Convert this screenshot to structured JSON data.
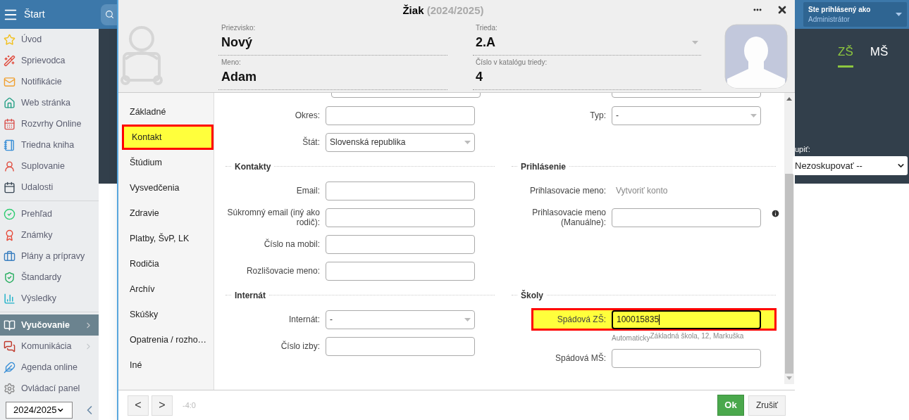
{
  "sidebar": {
    "title": "Štart",
    "groups": [
      {
        "items": [
          {
            "label": "Úvod",
            "selected": false,
            "has_submenu": false
          },
          {
            "label": "Sprievodca",
            "selected": false,
            "has_submenu": false
          },
          {
            "label": "Notifikácie",
            "selected": false,
            "has_submenu": false
          },
          {
            "label": "Web stránka",
            "selected": false,
            "has_submenu": false
          },
          {
            "label": "Rozvrhy Online",
            "selected": false,
            "has_submenu": false
          },
          {
            "label": "Triedna kniha",
            "selected": false,
            "has_submenu": false
          },
          {
            "label": "Suplovanie",
            "selected": false,
            "has_submenu": false
          },
          {
            "label": "Udalosti",
            "selected": false,
            "has_submenu": false
          }
        ]
      },
      {
        "items": [
          {
            "label": "Prehľad",
            "selected": false,
            "has_submenu": false
          },
          {
            "label": "Známky",
            "selected": false,
            "has_submenu": false
          },
          {
            "label": "Plány a prípravy",
            "selected": false,
            "has_submenu": false
          },
          {
            "label": "Štandardy",
            "selected": false,
            "has_submenu": false
          },
          {
            "label": "Výsledky",
            "selected": false,
            "has_submenu": false
          }
        ]
      },
      {
        "items": [
          {
            "label": "Vyučovanie",
            "selected": true,
            "has_submenu": true
          },
          {
            "label": "Komunikácia",
            "selected": false,
            "has_submenu": true
          },
          {
            "label": "Agenda online",
            "selected": false,
            "has_submenu": false
          },
          {
            "label": "Ovládací panel",
            "selected": false,
            "has_submenu": false
          }
        ]
      }
    ],
    "year_select": {
      "value": "2024/2025"
    }
  },
  "user_panel": {
    "title": "Ste prihlásený ako",
    "role": "Administrátor"
  },
  "school_tabs": [
    {
      "label": "ZŠ",
      "selected": true
    },
    {
      "label": "MŠ",
      "selected": false
    }
  ],
  "group_select": {
    "label": "upiť:",
    "value": "Nezoskupovať --"
  },
  "dialog": {
    "title": "Žiak",
    "subtitle": "(2024/2025)",
    "header_fields": [
      {
        "label": "Priezvisko:",
        "value": "Nový",
        "kind": "text"
      },
      {
        "label": "Trieda:",
        "value": "2.A",
        "kind": "select"
      },
      {
        "label": "Meno:",
        "value": "Adam",
        "kind": "text"
      },
      {
        "label": "Číslo v katalógu triedy:",
        "value": "4",
        "kind": "text"
      }
    ],
    "nav": [
      {
        "label": "Základné",
        "selected": false
      },
      {
        "label": "Kontakt",
        "selected": true
      },
      {
        "label": "Štúdium",
        "selected": false
      },
      {
        "label": "Vysvedčenia",
        "selected": false
      },
      {
        "label": "Zdravie",
        "selected": false
      },
      {
        "label": "Platby, ŠvP, LK",
        "selected": false
      },
      {
        "label": "Rodičia",
        "selected": false
      },
      {
        "label": "Archív",
        "selected": false
      },
      {
        "label": "Skúšky",
        "selected": false
      },
      {
        "label": "Opatrenia / rozho…",
        "selected": false
      },
      {
        "label": "Iné",
        "selected": false
      }
    ],
    "bands": [
      {
        "left": {
          "fields": [
            {
              "kind": "input",
              "label": "Okres:",
              "highlighted": false
            },
            {
              "kind": "select",
              "label": "Štát:",
              "value": "Slovenská republika",
              "highlighted": false
            }
          ]
        },
        "right": {
          "fields": [
            {
              "kind": "select",
              "label": "Typ:",
              "value": "-",
              "highlighted": false
            }
          ]
        }
      },
      {
        "left": {
          "title": "Kontakty",
          "fields": [
            {
              "kind": "input",
              "label": "Email:",
              "highlighted": false
            },
            {
              "kind": "input",
              "label": "Súkromný email (iný ako rodič):",
              "highlighted": false
            },
            {
              "kind": "input",
              "label": "Číslo na mobil:",
              "highlighted": false
            },
            {
              "kind": "input",
              "label": "Rozlišovacie meno:",
              "highlighted": false
            }
          ]
        },
        "right": {
          "title": "Prihlásenie",
          "fields": [
            {
              "kind": "text",
              "label": "Prihlasovacie meno:",
              "value": "Vytvoriť konto",
              "highlighted": false
            },
            {
              "kind": "input",
              "label": "Prihlasovacie meno (Manuálne):",
              "highlighted": false,
              "info": true
            }
          ]
        }
      },
      {
        "left": {
          "title": "Internát",
          "fields": [
            {
              "kind": "select",
              "label": "Internát:",
              "value": "-",
              "highlighted": false
            },
            {
              "kind": "input",
              "label": "Číslo izby:",
              "highlighted": false
            }
          ]
        },
        "right": {
          "title": "Školy",
          "fields": [
            {
              "kind": "input",
              "label": "Spádová ZŠ:",
              "value": "100015835",
              "highlighted": true,
              "hint": "Automaticky",
              "hint_detail": "Základná škola, 12, Markuška"
            },
            {
              "kind": "input",
              "label": "Spádová MŠ:",
              "highlighted": false
            }
          ]
        }
      }
    ],
    "footer": {
      "prev": "<",
      "next": ">",
      "counter": "-4:0",
      "ok": "Ok",
      "cancel": "Zrušiť"
    }
  }
}
